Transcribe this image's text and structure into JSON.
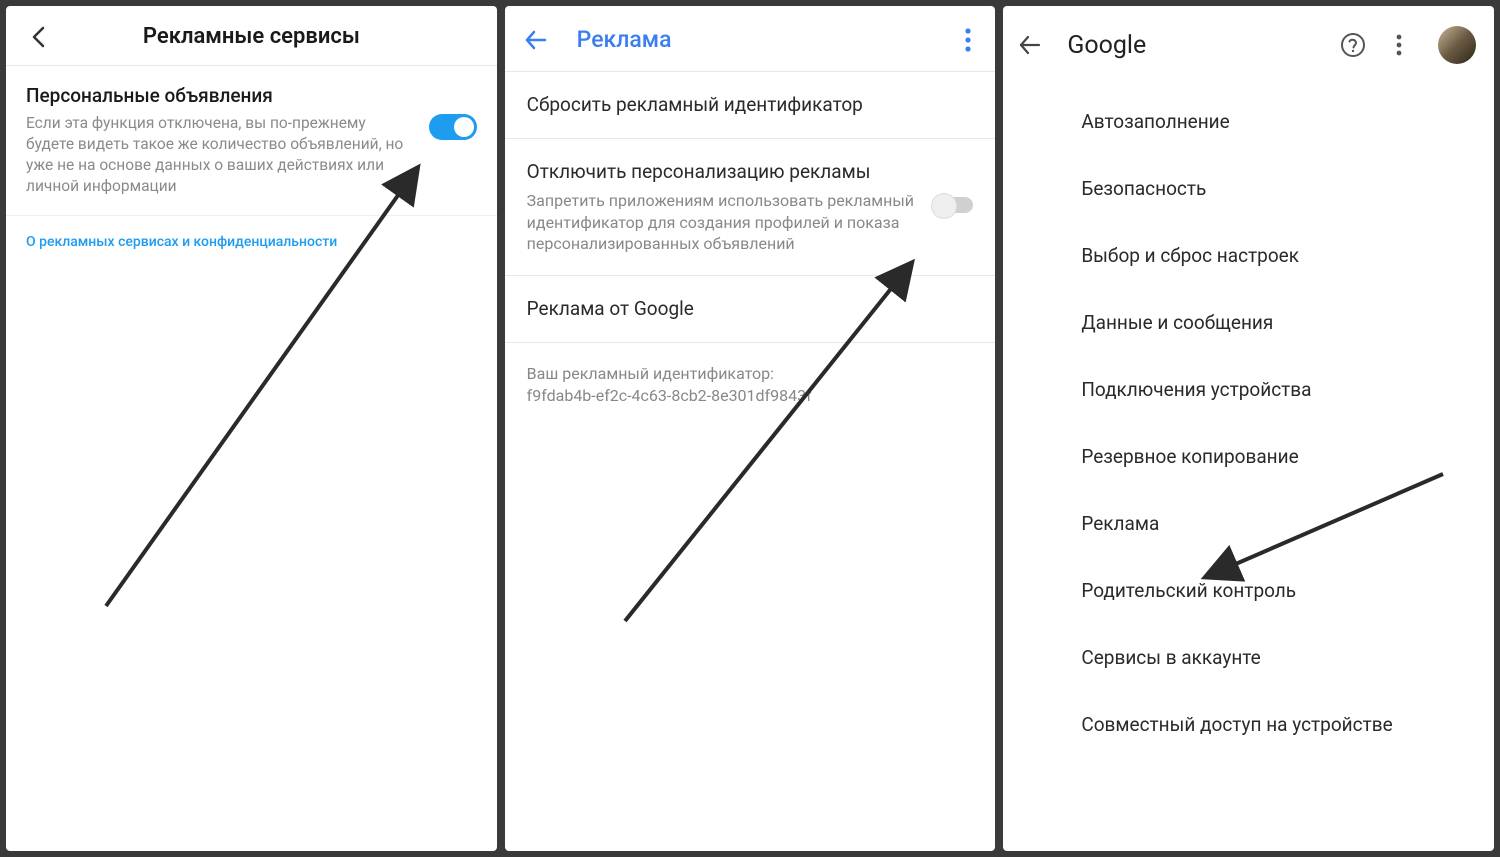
{
  "screen1": {
    "title": "Рекламные сервисы",
    "personal_ads": {
      "title": "Персональные объявления",
      "desc": "Если эта функция отключена, вы по-прежнему будете видеть такое же количество объявлений, но уже не на основе данных о ваших действиях или личной информации"
    },
    "about_link": "О рекламных сервисах и конфиденциальности"
  },
  "screen2": {
    "title": "Реклама",
    "reset": "Сбросить рекламный идентификатор",
    "disable": {
      "title": "Отключить персонализацию рекламы",
      "desc": "Запретить приложениям использовать рекламный идентификатор для создания профилей и показа персонализированных объявлений"
    },
    "google_ads": "Реклама от Google",
    "id_label": "Ваш рекламный идентификатор:",
    "id_value": "f9fdab4b-ef2c-4c63-8cb2-8e301df9843f"
  },
  "screen3": {
    "title": "Google",
    "items": [
      "Автозаполнение",
      "Безопасность",
      "Выбор и сброс настроек",
      "Данные и сообщения",
      "Подключения устройства",
      "Резервное копирование",
      "Реклама",
      "Родительский контроль",
      "Сервисы в аккаунте",
      "Совместный доступ на устройстве"
    ]
  }
}
